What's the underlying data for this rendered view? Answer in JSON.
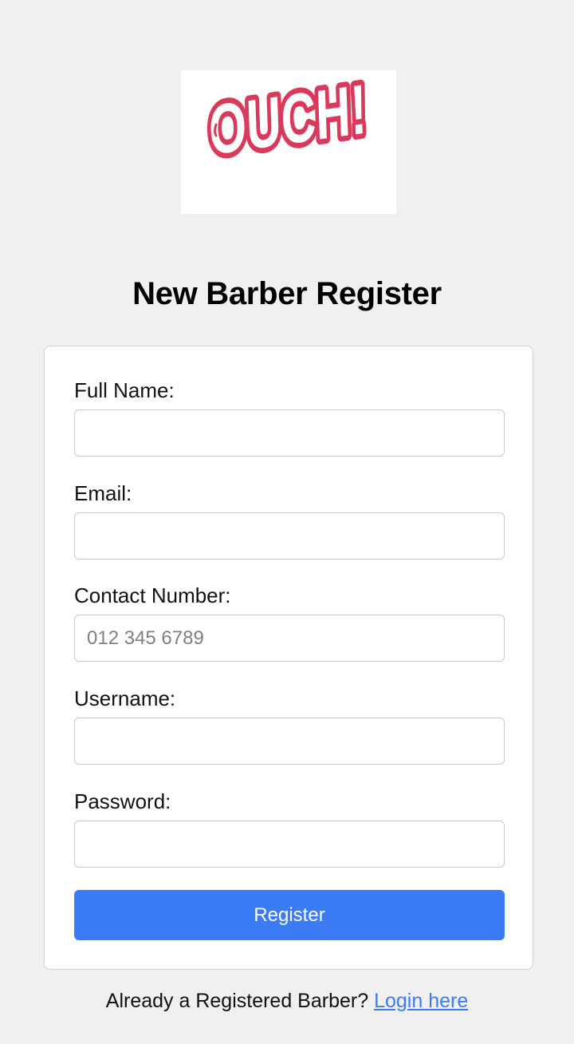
{
  "logo": {
    "text": "OUCH!",
    "icon": "ouch-logo",
    "color": "#d93a5c",
    "shadow_color": "#e6e6e6"
  },
  "title": "New Barber Register",
  "form": {
    "fields": [
      {
        "label": "Full Name:",
        "value": "",
        "placeholder": ""
      },
      {
        "label": "Email:",
        "value": "",
        "placeholder": ""
      },
      {
        "label": "Contact Number:",
        "value": "",
        "placeholder": "012 345 6789"
      },
      {
        "label": "Username:",
        "value": "",
        "placeholder": ""
      },
      {
        "label": "Password:",
        "value": "",
        "placeholder": ""
      }
    ],
    "submit_label": "Register"
  },
  "footer": {
    "prompt": "Already a Registered Barber?",
    "link_label": "Login here"
  },
  "colors": {
    "background": "#f0f0f0",
    "accent": "#3b7cf4",
    "card": "#ffffff"
  }
}
